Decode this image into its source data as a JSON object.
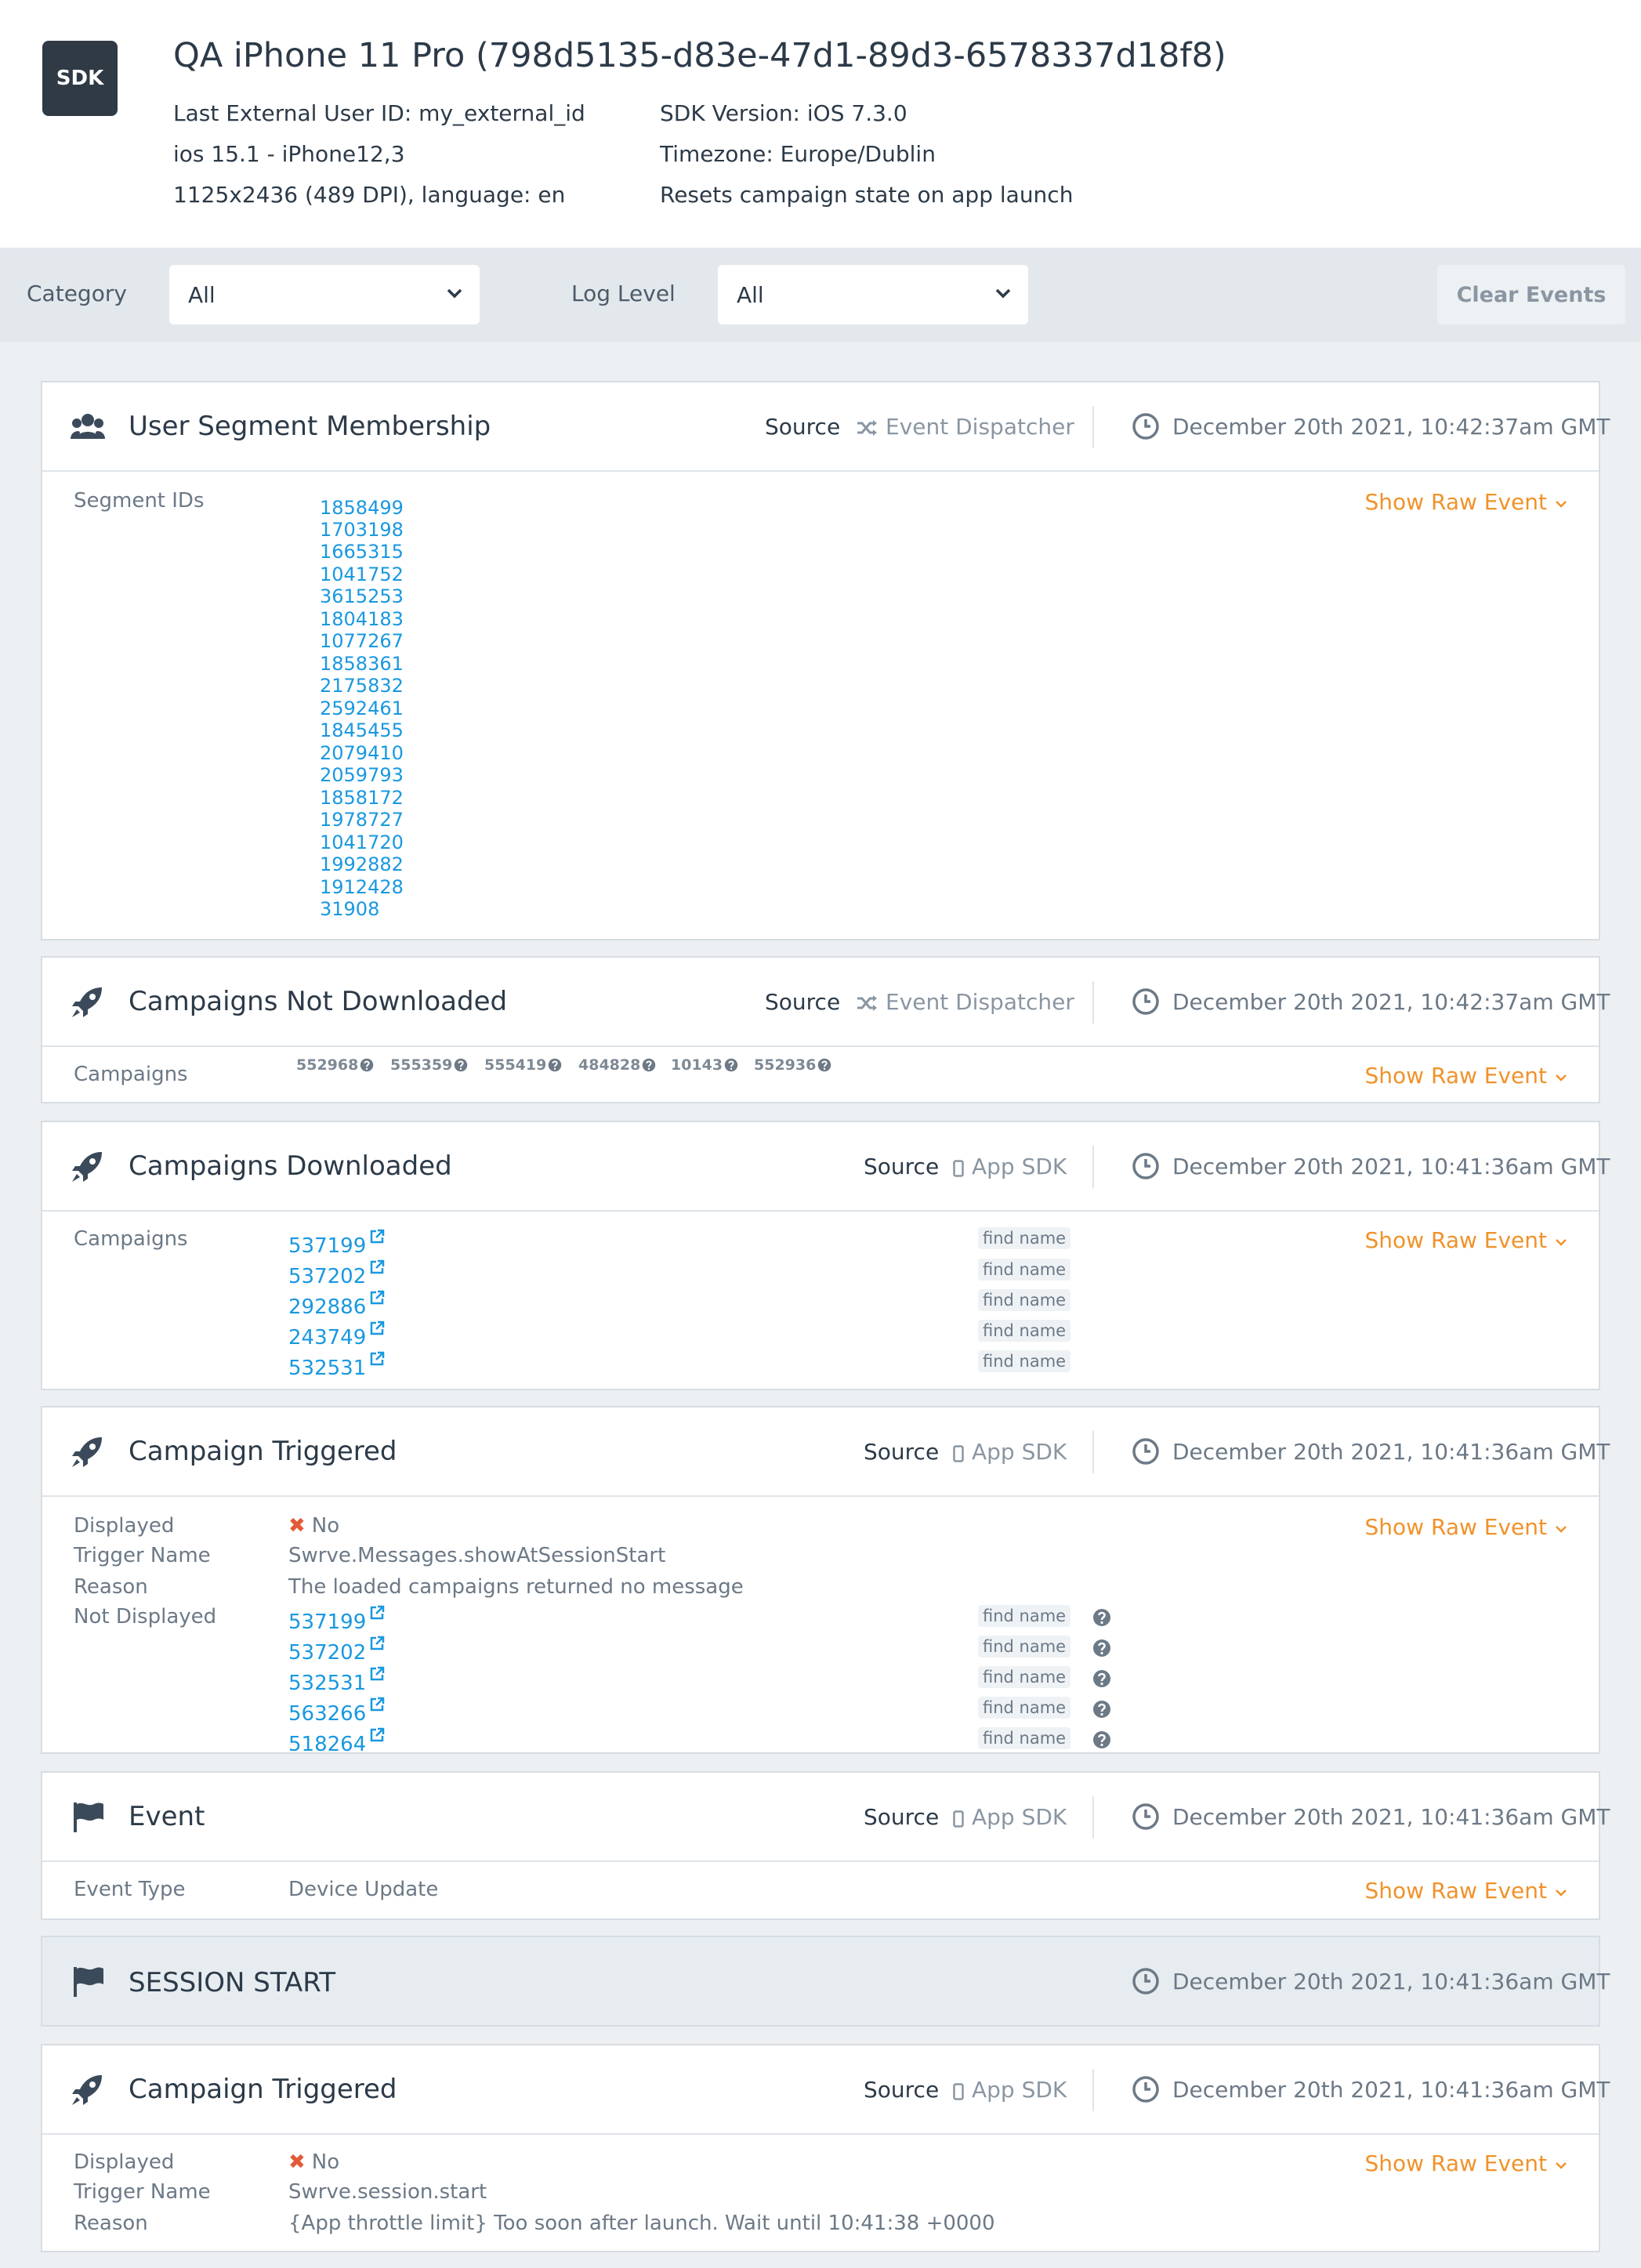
{
  "device": {
    "badge": "SDK",
    "title": "QA iPhone 11 Pro (798d5135-d83e-47d1-89d3-6578337d18f8)",
    "external_user_id": "Last External User ID: my_external_id",
    "os_model": "ios 15.1 - iPhone12,3",
    "screen_lang": "1125x2436 (489 DPI), language: en",
    "sdk_version": "SDK Version: iOS 7.3.0",
    "timezone": "Timezone: Europe/Dublin",
    "resets": "Resets campaign state on app launch"
  },
  "filters": {
    "category_label": "Category",
    "category_value": "All",
    "log_level_label": "Log Level",
    "log_level_value": "All",
    "clear_label": "Clear Events"
  },
  "common": {
    "source_label": "Source",
    "show_raw": "Show Raw Event",
    "find_name": "find name"
  },
  "events": {
    "segments": {
      "title": "User Segment Membership",
      "source": "Event Dispatcher",
      "time": "December 20th 2021, 10:42:37am GMT",
      "label": "Segment IDs",
      "ids": [
        "1858499",
        "1703198",
        "1665315",
        "1041752",
        "3615253",
        "1804183",
        "1077267",
        "1858361",
        "2175832",
        "2592461",
        "1845455",
        "2079410",
        "2059793",
        "1858172",
        "1978727",
        "1041720",
        "1992882",
        "1912428",
        "31908"
      ]
    },
    "not_downloaded": {
      "title": "Campaigns Not Downloaded",
      "source": "Event Dispatcher",
      "time": "December 20th 2021, 10:42:37am GMT",
      "label": "Campaigns",
      "ids": [
        "552968",
        "555359",
        "555419",
        "484828",
        "10143",
        "552936"
      ]
    },
    "downloaded": {
      "title": "Campaigns Downloaded",
      "source": "App SDK",
      "time": "December 20th 2021, 10:41:36am GMT",
      "label": "Campaigns",
      "ids": [
        "537199",
        "537202",
        "292886",
        "243749",
        "532531"
      ]
    },
    "triggered1": {
      "title": "Campaign Triggered",
      "source": "App SDK",
      "time": "December 20th 2021, 10:41:36am GMT",
      "displayed_label": "Displayed",
      "displayed_value": "No",
      "trigger_label": "Trigger Name",
      "trigger_value": "Swrve.Messages.showAtSessionStart",
      "reason_label": "Reason",
      "reason_value": "The loaded campaigns returned no message",
      "not_displayed_label": "Not Displayed",
      "ids": [
        "537199",
        "537202",
        "532531",
        "563266",
        "518264"
      ]
    },
    "event": {
      "title": "Event",
      "source": "App SDK",
      "time": "December 20th 2021, 10:41:36am GMT",
      "type_label": "Event Type",
      "type_value": "Device Update"
    },
    "session": {
      "title": "SESSION START",
      "time": "December 20th 2021, 10:41:36am GMT"
    },
    "triggered2": {
      "title": "Campaign Triggered",
      "source": "App SDK",
      "time": "December 20th 2021, 10:41:36am GMT",
      "displayed_label": "Displayed",
      "displayed_value": "No",
      "trigger_label": "Trigger Name",
      "trigger_value": "Swrve.session.start",
      "reason_label": "Reason",
      "reason_value": "{App throttle limit} Too soon after launch. Wait until 10:41:38 +0000"
    }
  }
}
